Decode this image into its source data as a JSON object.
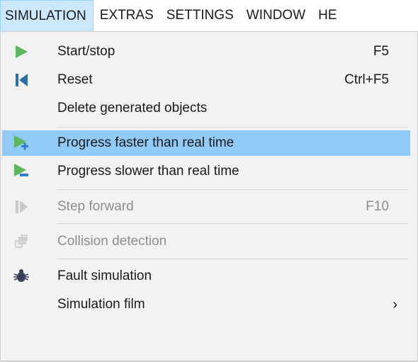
{
  "menubar": {
    "items": [
      {
        "label": "SIMULATION",
        "active": true
      },
      {
        "label": "EXTRAS"
      },
      {
        "label": "SETTINGS"
      },
      {
        "label": "WINDOW"
      },
      {
        "label": "HE"
      }
    ]
  },
  "menu": {
    "start_stop": {
      "label": "Start/stop",
      "shortcut": "F5",
      "icon": "play-icon"
    },
    "reset": {
      "label": "Reset",
      "shortcut": "Ctrl+F5",
      "icon": "reset-icon"
    },
    "delete_generated": {
      "label": "Delete generated objects"
    },
    "progress_faster": {
      "label": "Progress faster than real time",
      "icon": "play-plus-icon",
      "highlighted": true
    },
    "progress_slower": {
      "label": "Progress slower than real time",
      "icon": "play-minus-icon"
    },
    "step_forward": {
      "label": "Step forward",
      "shortcut": "F10",
      "icon": "step-forward-icon",
      "disabled": true
    },
    "collision_detection": {
      "label": "Collision detection",
      "icon": "collision-icon",
      "disabled": true
    },
    "fault_simulation": {
      "label": "Fault simulation",
      "icon": "bug-icon"
    },
    "simulation_film": {
      "label": "Simulation film",
      "submenu_glyph": "›"
    }
  },
  "colors": {
    "menubar_active_bg": "#cce8ff",
    "highlight_bg": "#91c9f7",
    "play_green": "#5cb85c",
    "reset_blue": "#2e6da4",
    "plus_blue": "#2e7fd1",
    "disabled_text": "#8d8d8d"
  }
}
